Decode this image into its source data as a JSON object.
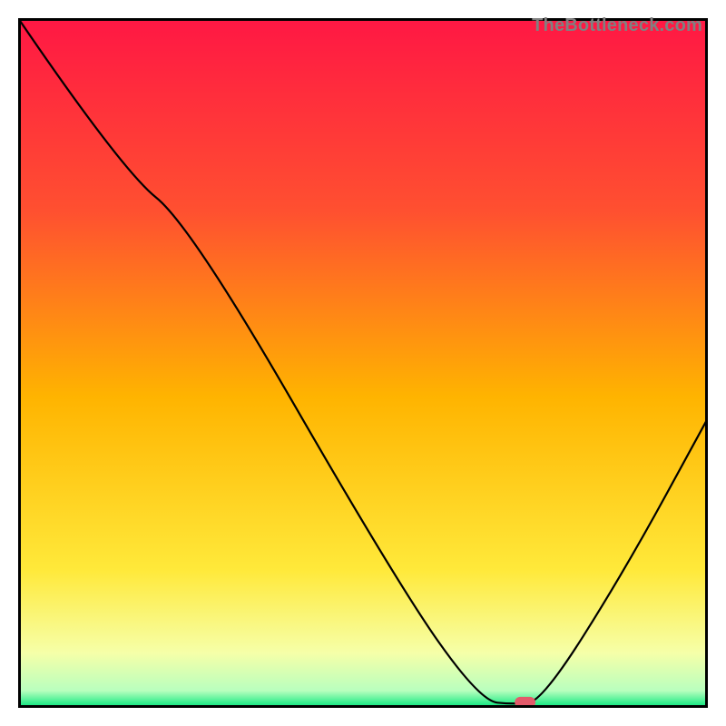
{
  "watermark": "TheBottleneck.com",
  "chart_data": {
    "type": "line",
    "title": "",
    "xlabel": "",
    "ylabel": "",
    "xlim": [
      0,
      100
    ],
    "ylim": [
      0,
      100
    ],
    "background_gradient": {
      "orientation": "vertical",
      "stops": [
        {
          "offset": 0.0,
          "color": "#ff1744"
        },
        {
          "offset": 0.28,
          "color": "#ff5030"
        },
        {
          "offset": 0.55,
          "color": "#ffb400"
        },
        {
          "offset": 0.8,
          "color": "#ffe93a"
        },
        {
          "offset": 0.92,
          "color": "#f6ffa8"
        },
        {
          "offset": 0.975,
          "color": "#b9ffbe"
        },
        {
          "offset": 1.0,
          "color": "#00e67a"
        }
      ]
    },
    "series": [
      {
        "name": "bottleneck-curve",
        "color": "#000000",
        "width": 2.2,
        "points": [
          {
            "x": 0.0,
            "y": 100.0
          },
          {
            "x": 15.0,
            "y": 78.0
          },
          {
            "x": 25.0,
            "y": 70.0
          },
          {
            "x": 55.0,
            "y": 18.0
          },
          {
            "x": 67.0,
            "y": 1.0
          },
          {
            "x": 72.0,
            "y": 0.5
          },
          {
            "x": 76.0,
            "y": 1.0
          },
          {
            "x": 88.0,
            "y": 20.0
          },
          {
            "x": 100.0,
            "y": 42.0
          }
        ]
      }
    ],
    "marker": {
      "x": 73.5,
      "y": 0.8,
      "width": 3.0,
      "height": 1.6,
      "color": "#e35a6a"
    },
    "frame_color": "#000000",
    "frame_width": 3
  }
}
